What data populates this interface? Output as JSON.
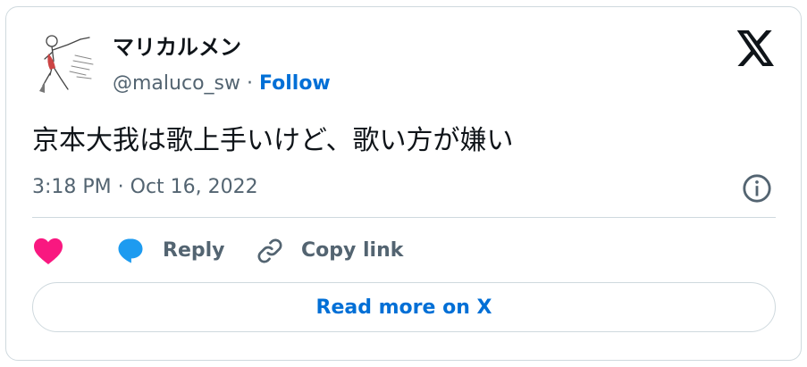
{
  "author": {
    "display_name": "マリカルメン",
    "handle": "@maluco_sw",
    "separator": "·",
    "follow_label": "Follow"
  },
  "tweet": {
    "text": "京本大我は歌上手いけど、歌い方が嫌い",
    "timestamp": "3:18 PM · Oct 16, 2022"
  },
  "actions": {
    "reply_label": "Reply",
    "copy_link_label": "Copy link"
  },
  "footer": {
    "read_more_label": "Read more on X"
  },
  "icons": {
    "brand": "x-logo-icon",
    "info": "info-icon",
    "like": "heart-icon",
    "reply": "reply-bubble-icon",
    "copy": "link-icon"
  },
  "colors": {
    "link": "#006fd6",
    "like": "#f91880",
    "reply": "#1d9bf0",
    "muted": "#536471",
    "border": "#cfd9de"
  }
}
